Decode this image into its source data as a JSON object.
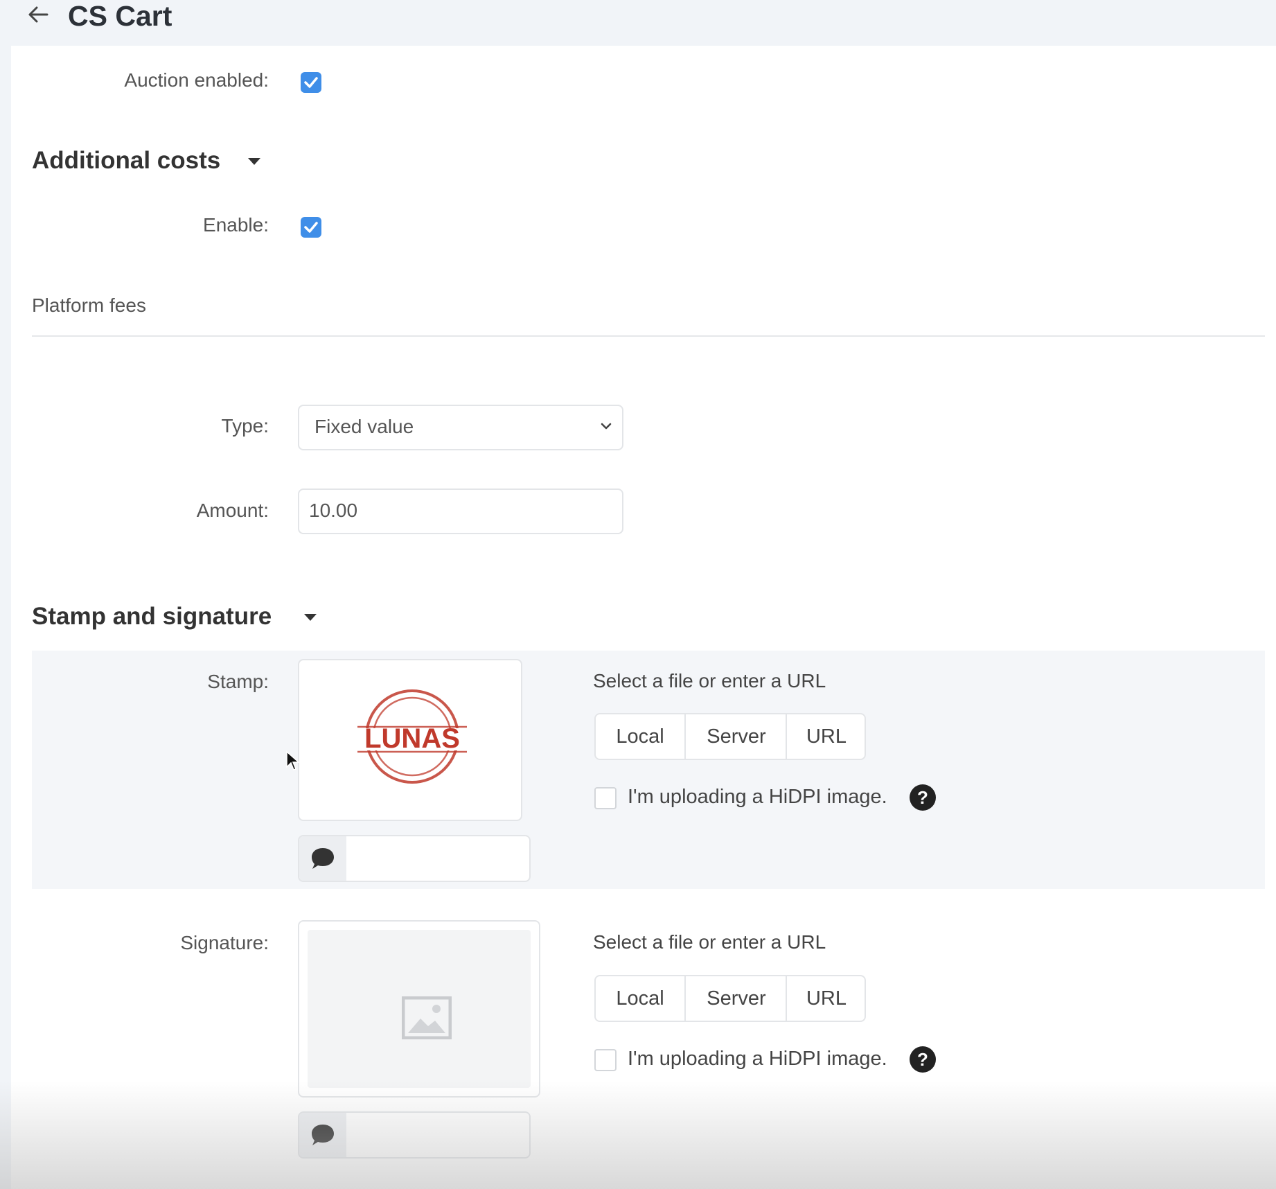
{
  "header": {
    "title": "CS Cart",
    "back_icon": "arrow-left-icon"
  },
  "auction": {
    "label": "Auction enabled:",
    "checked": true
  },
  "additional_costs": {
    "title": "Additional costs",
    "enable_label": "Enable:",
    "enable_checked": true,
    "subheading": "Platform fees",
    "type_label": "Type:",
    "type_value": "Fixed value",
    "amount_label": "Amount:",
    "amount_value": "10.00"
  },
  "stamp_signature": {
    "title": "Stamp and signature",
    "stamp": {
      "label": "Stamp:",
      "image_text": "LUNAS",
      "hint": "Select a file or enter a URL",
      "buttons": [
        "Local",
        "Server",
        "URL"
      ],
      "hidpi_label": "I'm uploading a HiDPI image.",
      "hidpi_checked": false,
      "alt_text": ""
    },
    "signature": {
      "label": "Signature:",
      "hint": "Select a file or enter a URL",
      "buttons": [
        "Local",
        "Server",
        "URL"
      ],
      "hidpi_label": "I'm uploading a HiDPI image.",
      "hidpi_checked": false,
      "alt_text": ""
    }
  },
  "colors": {
    "accent": "#3f8ee8",
    "stamp_red": "#c0392b",
    "band": "#f4f6f9"
  }
}
